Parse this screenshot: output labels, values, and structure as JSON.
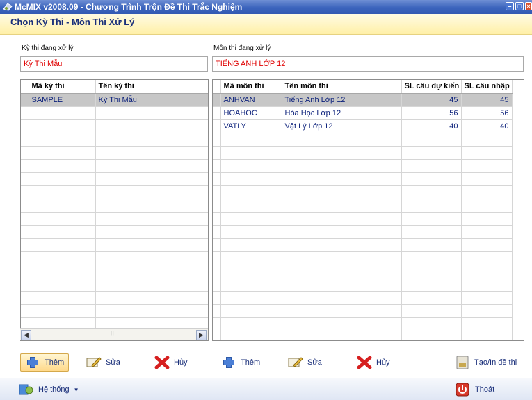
{
  "window": {
    "title": "McMIX v2008.09 - Chương Trình Trộn Đề Thi Trắc Nghiệm",
    "subtitle": "Chọn Kỳ Thi - Môn Thi Xử Lý"
  },
  "left": {
    "label": "Kỳ thi đang xử lý",
    "value": "Kỳ Thi Mẫu",
    "columns": [
      "Mã kỳ thi",
      "Tên kỳ thi"
    ],
    "rows": [
      {
        "code": "SAMPLE",
        "name": "Kỳ Thi Mẫu"
      }
    ],
    "empty_rows": 17
  },
  "right": {
    "label": "Môn thi đang xử lý",
    "value": "TIẾNG ANH LỚP 12",
    "columns": [
      "Mã môn thi",
      "Tên môn thi",
      "SL câu dự kiến",
      "SL câu nhập"
    ],
    "rows": [
      {
        "code": "ANHVAN",
        "name": "Tiếng Anh Lớp 12",
        "expected": "45",
        "entered": "45"
      },
      {
        "code": "HOAHOC",
        "name": "Hóa Học Lớp 12",
        "expected": "56",
        "entered": "56"
      },
      {
        "code": "VATLY",
        "name": "Vật Lý Lớp 12",
        "expected": "40",
        "entered": "40"
      }
    ],
    "empty_rows": 16
  },
  "toolbar": {
    "exam_add": "Thêm",
    "exam_edit": "Sửa",
    "exam_delete": "Hủy",
    "subject_add": "Thêm",
    "subject_edit": "Sửa",
    "subject_delete": "Hủy",
    "create_print": "Tạo/In đề thi"
  },
  "footer": {
    "system": "Hệ thống",
    "exit": "Thoát"
  },
  "colors": {
    "selected_row": "#c7c7c7",
    "field_text": "#e00000",
    "title_bar": "#3c64bd"
  }
}
